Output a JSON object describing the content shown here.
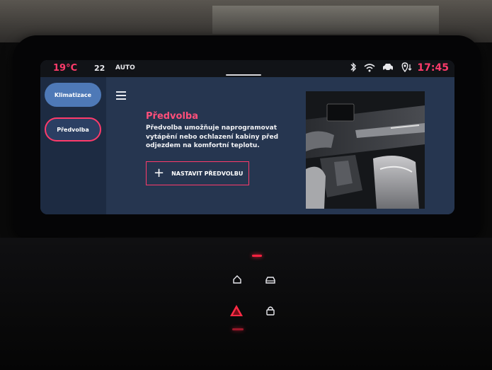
{
  "status": {
    "temperature": "19°C",
    "fan_level": "22",
    "mode": "AUTO",
    "time": "17:45",
    "icons": [
      "bluetooth-icon",
      "wifi-icon",
      "car-connect-icon",
      "location-icon"
    ]
  },
  "sidebar": {
    "items": [
      {
        "label": "Klimatizace",
        "active": false
      },
      {
        "label": "Předvolba",
        "active": true
      }
    ]
  },
  "main": {
    "menu_icon": "hamburger-icon",
    "title": "Předvolba",
    "description": "Předvolba umožňuje naprogramovat vytápění nebo ochlazení kabiny před odjezdem na komfortní teplotu.",
    "action_label": "NASTAVIT PŘEDVOLBU",
    "action_icon": "plus-icon"
  },
  "colors": {
    "accent": "#ff3b6b",
    "panel": "#263650",
    "rail": "#1d2b42",
    "pill_active": "#4e79b7"
  },
  "console": {
    "buttons": [
      "home-icon",
      "car-icon",
      "hazard-icon",
      "lock-icon"
    ]
  }
}
